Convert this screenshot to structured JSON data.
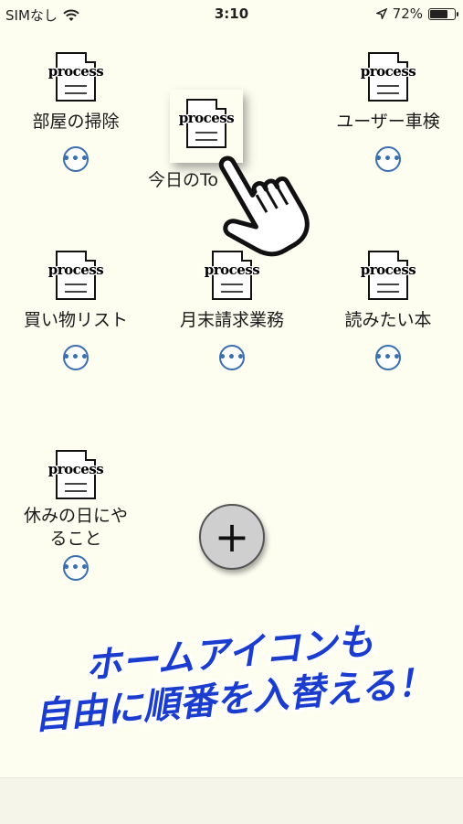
{
  "status_bar": {
    "carrier": "SIMなし",
    "time": "3:10",
    "battery_percent": "72%",
    "battery_level": 0.72
  },
  "icon_word": "process",
  "more_glyph": "•••",
  "items": [
    {
      "label": "部屋の掃除"
    },
    {
      "label": "ユーザー車検"
    },
    {
      "label": "買い物リスト"
    },
    {
      "label": "月末請求業務"
    },
    {
      "label": "読みたい本"
    },
    {
      "label": "休みの日にや\nること"
    }
  ],
  "dragged_item": {
    "label": "今日のTo"
  },
  "add_button": {
    "glyph": "+"
  },
  "promo": {
    "line1": "ホームアイコンも",
    "line2": "自由に順番を入替える！"
  },
  "colors": {
    "background": "#fdfdf0",
    "promo_text": "#1a3ccf",
    "more_button": "#3b6fb0"
  }
}
